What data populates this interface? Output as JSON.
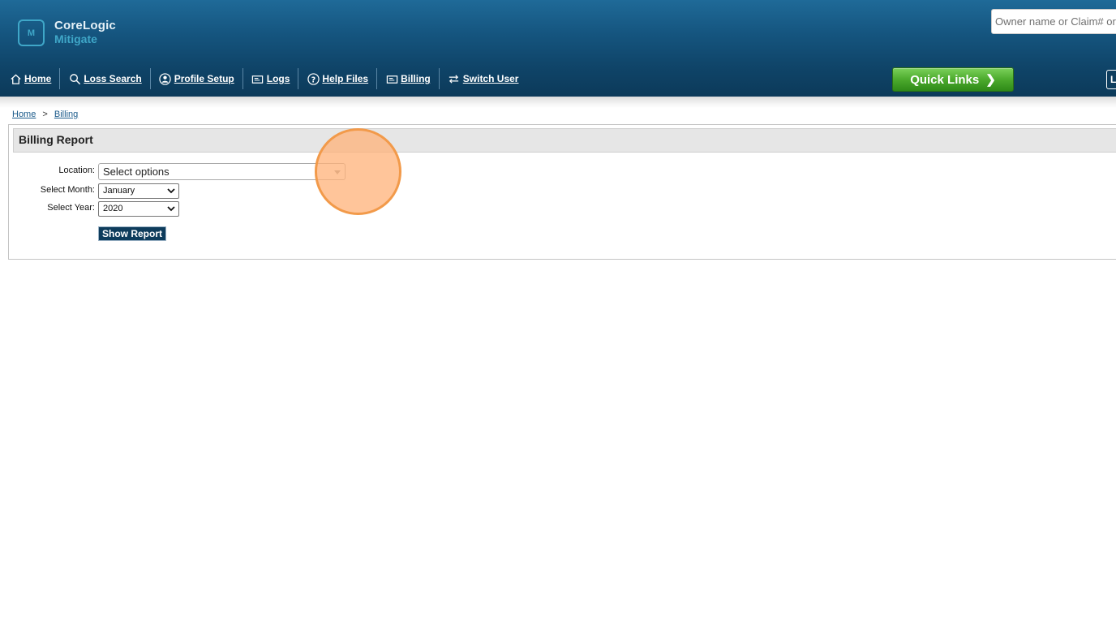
{
  "brand": {
    "logo_mark": "M",
    "name_line1": "CoreLogic",
    "name_line2": "Mitigate"
  },
  "search": {
    "placeholder": "Owner name or Claim# or"
  },
  "nav": {
    "items": [
      {
        "label": "Home",
        "icon": "home-icon"
      },
      {
        "label": "Loss Search",
        "icon": "search-icon"
      },
      {
        "label": "Profile Setup",
        "icon": "profile-icon"
      },
      {
        "label": "Logs",
        "icon": "logs-icon"
      },
      {
        "label": "Help Files",
        "icon": "help-icon"
      },
      {
        "label": "Billing",
        "icon": "billing-icon"
      },
      {
        "label": "Switch User",
        "icon": "switch-user-icon"
      }
    ],
    "quick_links_label": "Quick Links",
    "edge_button_label": "L"
  },
  "breadcrumb": {
    "home": "Home",
    "separator": ">",
    "current": "Billing"
  },
  "report": {
    "title": "Billing Report",
    "location_label": "Location:",
    "location_value": "Select options",
    "month_label": "Select Month:",
    "month_value": "January",
    "year_label": "Select Year:",
    "year_value": "2020",
    "show_button": "Show Report"
  },
  "colors": {
    "header_top": "#1f6a98",
    "header_bottom": "#0c3a5a",
    "quick_links_green": "#4caa2d",
    "button_navy": "#0e3c5c",
    "click_marker": "#f29a4a"
  }
}
